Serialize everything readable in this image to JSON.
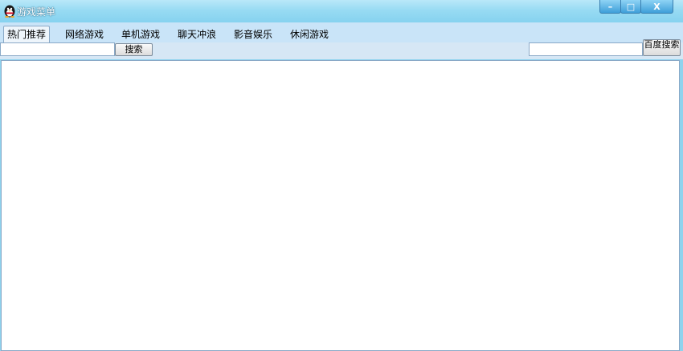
{
  "window": {
    "title": "游戏菜单",
    "minimize_symbol": "–",
    "maximize_symbol": "□",
    "close_symbol": "X"
  },
  "tabs": [
    {
      "label": "热门推荐",
      "active": true
    },
    {
      "label": "网络游戏",
      "active": false
    },
    {
      "label": "单机游戏",
      "active": false
    },
    {
      "label": "聊天冲浪",
      "active": false
    },
    {
      "label": "影音娱乐",
      "active": false
    },
    {
      "label": "休闲游戏",
      "active": false
    }
  ],
  "search": {
    "left_value": "",
    "left_button": "搜索",
    "right_value": "",
    "right_button": "百度搜索"
  },
  "colors": {
    "titlebar": "#98dbf3",
    "tabstrip": "#c9e4f8",
    "content": "#ffffff"
  }
}
